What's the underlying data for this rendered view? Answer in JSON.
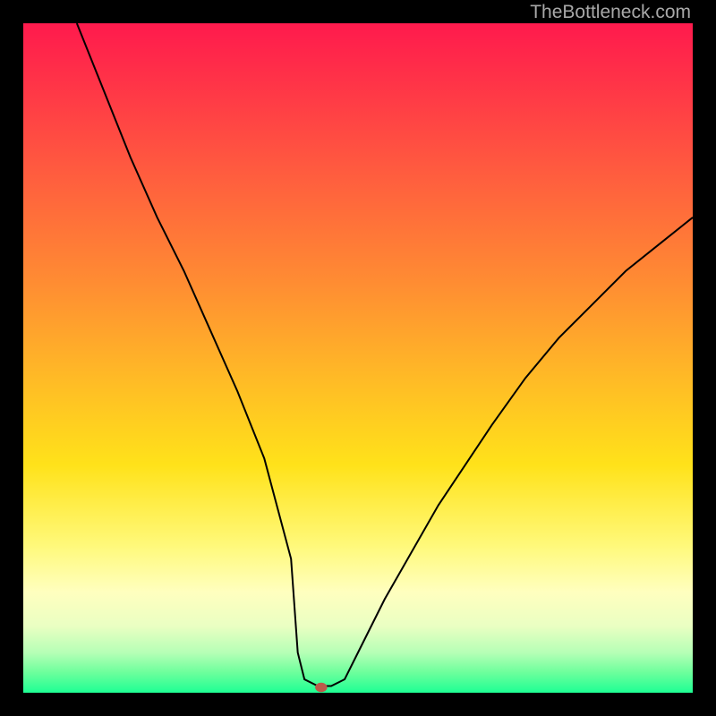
{
  "watermark": "TheBottleneck.com",
  "chart_data": {
    "type": "line",
    "title": "",
    "xlabel": "",
    "ylabel": "",
    "xlim": [
      0,
      100
    ],
    "ylim": [
      0,
      100
    ],
    "series": [
      {
        "name": "bottleneck-curve",
        "x": [
          8,
          12,
          16,
          20,
          24,
          28,
          32,
          36,
          40,
          41,
          42,
          44,
          46,
          48,
          50,
          54,
          58,
          62,
          66,
          70,
          75,
          80,
          85,
          90,
          95,
          100
        ],
        "y": [
          100,
          90,
          80,
          71,
          63,
          54,
          45,
          35,
          20,
          6,
          2,
          1,
          1,
          2,
          6,
          14,
          21,
          28,
          34,
          40,
          47,
          53,
          58,
          63,
          67,
          71
        ]
      }
    ],
    "marker": {
      "x": 44.5,
      "y": 0.8
    },
    "colors": {
      "curve": "#000000",
      "marker": "#bc5a4a",
      "background_top": "#ff1a4d",
      "background_bottom": "#1eff94"
    }
  }
}
